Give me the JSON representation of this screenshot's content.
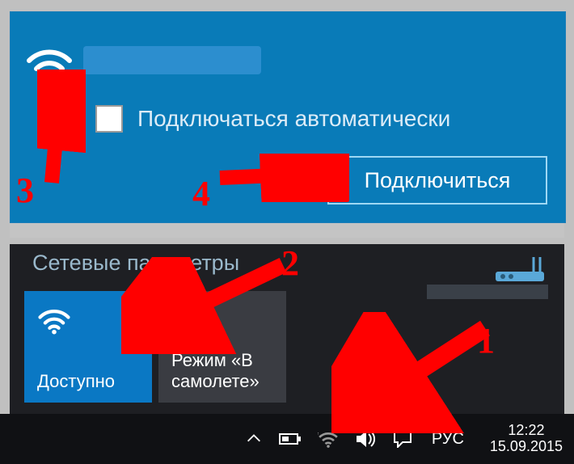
{
  "network": {
    "auto_connect_label": "Подключаться автоматически",
    "connect_button": "Подключиться"
  },
  "settings": {
    "title": "Сетевые параметры",
    "tile_wifi": "Доступно",
    "tile_airplane": "Режим «В самолете»"
  },
  "taskbar": {
    "lang": "РУС",
    "time": "12:22",
    "date": "15.09.2015"
  },
  "annotations": {
    "n1": "1",
    "n2": "2",
    "n3": "3",
    "n4": "4"
  }
}
